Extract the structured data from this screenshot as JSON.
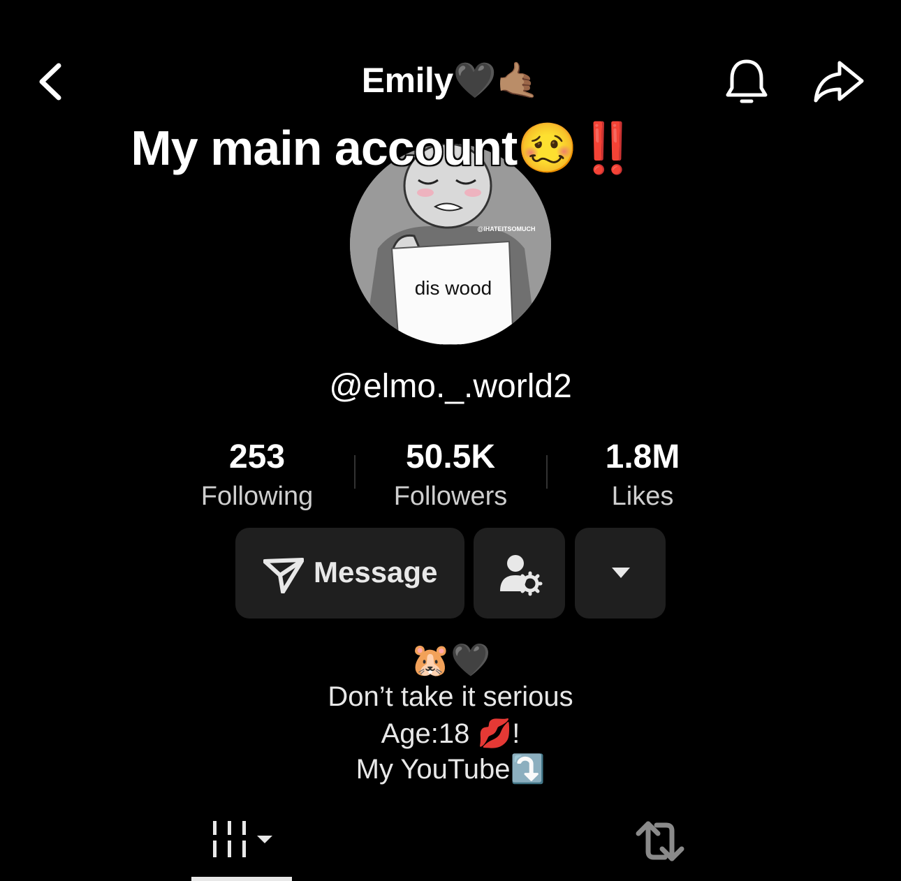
{
  "header": {
    "title": "Emily🖤🤙🏽",
    "back_icon": "chevron-left-icon",
    "bell_icon": "bell-icon",
    "share_icon": "share-arrow-icon"
  },
  "overlay_caption": "My main account🥴‼️",
  "avatar": {
    "watermark": "@IHATEITSOMUCH",
    "sign_text": "dis wood"
  },
  "profile": {
    "handle": "@elmo._.world2"
  },
  "stats": [
    {
      "value": "253",
      "label": "Following"
    },
    {
      "value": "50.5K",
      "label": "Followers"
    },
    {
      "value": "1.8M",
      "label": "Likes"
    }
  ],
  "actions": {
    "message_label": "Message",
    "follow_settings_icon": "person-gear-icon",
    "more_icon": "caret-down-icon"
  },
  "bio": {
    "emoji_line": "🐹🖤",
    "line1": "Don’t take it serious",
    "line2": "Age:18 💋!",
    "line3": "My YouTube⤵️"
  },
  "tabs": {
    "videos_icon": "video-grid-icon",
    "reposts_icon": "repost-icon"
  },
  "colors": {
    "background": "#000000",
    "button_bg": "#1f1f1f",
    "text": "#ffffff",
    "muted": "#cfcfcf"
  }
}
